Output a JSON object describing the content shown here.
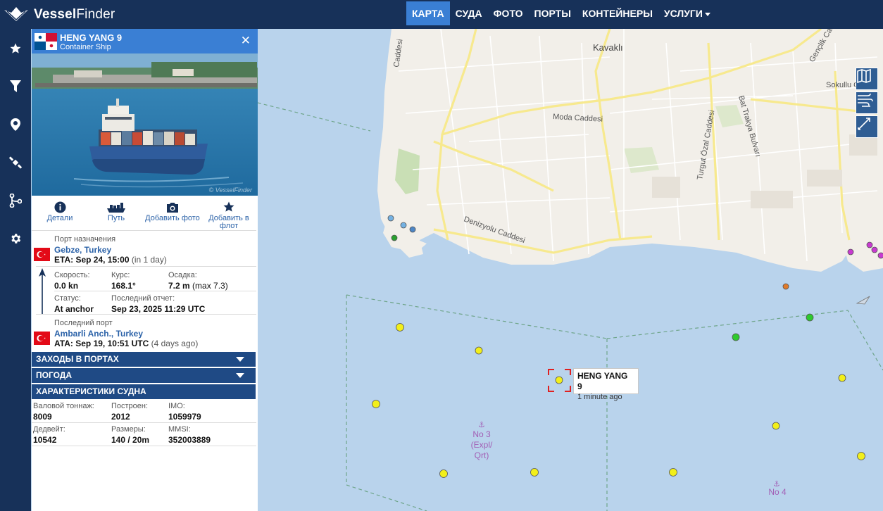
{
  "brand": {
    "name_bold": "Vessel",
    "name_rest": "Finder"
  },
  "nav": [
    {
      "label": "КАРТА",
      "active": true
    },
    {
      "label": "СУДА",
      "active": false
    },
    {
      "label": "ФОТО",
      "active": false
    },
    {
      "label": "ПОРТЫ",
      "active": false
    },
    {
      "label": "КОНТЕЙНЕРЫ",
      "active": false
    },
    {
      "label": "УСЛУГИ",
      "active": false
    }
  ],
  "rail": [
    "star-icon",
    "filter-icon",
    "location-pin-icon",
    "satellite-icon",
    "route-icon",
    "gear-icon"
  ],
  "vessel": {
    "name": "HENG YANG 9",
    "type": "Container Ship",
    "photo_watermark": "© VesselFinder",
    "actions": {
      "details": "Детали",
      "track": "Путь",
      "add_photo": "Добавить фото",
      "add_fleet_line1": "Добавить в",
      "add_fleet_line2": "флот"
    },
    "destination": {
      "label": "Порт назначения",
      "port": "Gebze, Turkey",
      "eta_label": "ETA:",
      "eta": "Sep 24, 15:00",
      "eta_note": "(in 1 day)"
    },
    "speed": {
      "label": "Скорость:",
      "value": "0.0 kn"
    },
    "course": {
      "label": "Курс:",
      "value": "168.1°"
    },
    "draught": {
      "label": "Осадка:",
      "value": "7.2 m",
      "note": "(max 7.3)"
    },
    "status": {
      "label": "Статус:",
      "value": "At anchor"
    },
    "last_report": {
      "label": "Последний отчет:",
      "value": "Sep 23, 2025 11:29 UTC"
    },
    "last_port": {
      "label": "Последний порт",
      "port": "Ambarli Anch., Turkey",
      "ata_label": "ATA:",
      "ata": "Sep 19, 10:51 UTC",
      "ata_note": "(4 days ago)"
    },
    "sections": {
      "port_calls": "ЗАХОДЫ В ПОРТАХ",
      "weather": "ПОГОДА",
      "specs": "ХАРАКТЕРИСТИКИ СУДНА"
    },
    "specs": {
      "gross_tonnage": {
        "label": "Валовой тоннаж:",
        "value": "8009"
      },
      "built": {
        "label": "Построен:",
        "value": "2012"
      },
      "imo": {
        "label": "IMO:",
        "value": "1059979"
      },
      "deadweight": {
        "label": "Дедвейт:",
        "value": "10542"
      },
      "size": {
        "label": "Размеры:",
        "value": "140 / 20m"
      },
      "mmsi": {
        "label": "MMSI:",
        "value": "352003889"
      }
    }
  },
  "map": {
    "streets": {
      "s1": "Caddesi",
      "s2": "Kavaklı",
      "s3": "Moda Caddesi",
      "s4": "Bat Trakya Bulvarı",
      "s5": "Turgut Özal Caddesi",
      "s6": "Denizyolu Caddesi",
      "s7": "Sokullu Cad",
      "s8": "Gençlik Cad"
    },
    "tooltip": {
      "name": "HENG YANG 9",
      "time": "1 minute ago"
    },
    "anchorages": [
      {
        "line1": "No 3",
        "line2": "(Expl/",
        "line3": "Qrt)"
      },
      {
        "line1": "No 4"
      }
    ],
    "tools": [
      "map-layers-icon",
      "wind-icon",
      "measure-icon"
    ]
  }
}
